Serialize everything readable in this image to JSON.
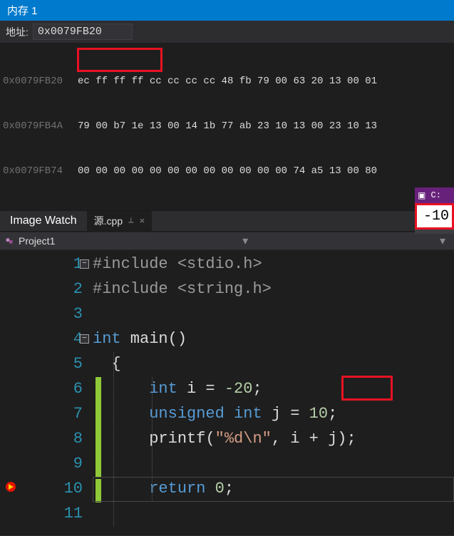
{
  "memory": {
    "title": "内存 1",
    "address_label": "地址:",
    "address_value": "0x0079FB20",
    "rows": [
      {
        "addr": "0x0079FB20",
        "hex": "ec ff ff ff cc cc cc cc 48 fb 79 00 63 20 13 00 01"
      },
      {
        "addr": "0x0079FB4A",
        "hex": "79 00 b7 1e 13 00 14 1b 77 ab 23 10 13 00 23 10 13"
      },
      {
        "addr": "0x0079FB74",
        "hex": "00 00 00 00 00 00 00 00 00 00 00 00 74 a5 13 00 80"
      }
    ]
  },
  "watch_title": "Image Watch",
  "tab": {
    "label": "源.cpp",
    "pin": "⟂",
    "close": "×"
  },
  "project": {
    "name": "Project1"
  },
  "code": {
    "line_numbers": [
      "1",
      "2",
      "3",
      "4",
      "5",
      "6",
      "7",
      "8",
      "9",
      "10",
      "11"
    ],
    "include1_k": "#include",
    "include1_h": " <stdio.h>",
    "include2_k": "#include",
    "include2_h": " <string.h>",
    "main_k1": "int",
    "main_fn": " main",
    "main_paren": "()",
    "brace_open": "{",
    "l6_k": "int",
    "l6_v": " i = ",
    "l6_n": "-20",
    "l6_s": ";",
    "l7_k": "unsigned int",
    "l7_v": " j = ",
    "l7_n": "10",
    "l7_s": ";",
    "l8_fn": "printf",
    "l8_p1": "(",
    "l8_str": "\"%d\\n\"",
    "l8_mid": ", i + j)",
    "l8_s": ";",
    "l10_k": "return",
    "l10_sp": " ",
    "l10_n": "0",
    "l10_s": ";"
  },
  "tooltip": {
    "header": "C:",
    "value": "-10"
  },
  "chart_data": null
}
